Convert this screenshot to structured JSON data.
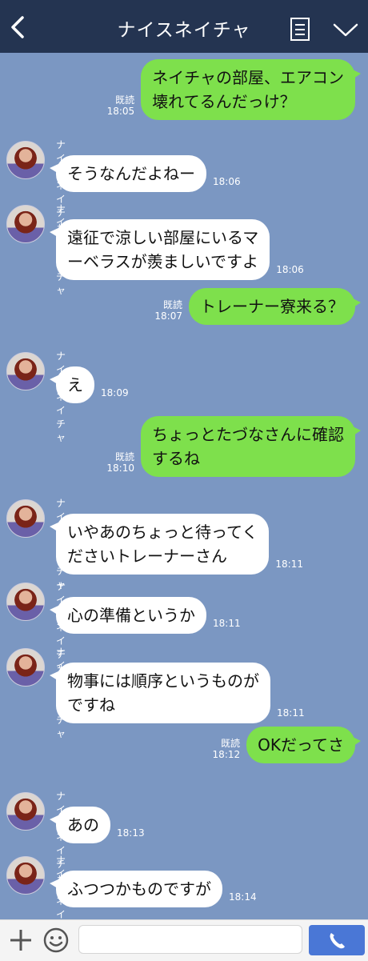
{
  "header": {
    "title": "ナイスネイチャ",
    "back_icon": "chevron-left-icon",
    "note_icon": "note-list-icon",
    "menu_icon": "chevron-down-icon"
  },
  "colors": {
    "header_bg": "#243451",
    "chat_bg": "#7b97c2",
    "outgoing_bubble": "#7ee04c",
    "incoming_bubble": "#ffffff",
    "call_button": "#4a77d6"
  },
  "messages": [
    {
      "direction": "out",
      "lines": [
        "ネイチャの部屋、エアコン",
        "壊れてるんだっけ？"
      ],
      "read_label": "既読",
      "time": "18:05"
    },
    {
      "direction": "in",
      "sender": "ナイスネイチャ",
      "lines": [
        "そうなんだよねー"
      ],
      "time": "18:06"
    },
    {
      "direction": "in",
      "sender": "ナイスネイチャ",
      "lines": [
        "遠征で涼しい部屋にいるマ",
        "ーベラスが羨ましいですよ"
      ],
      "time": "18:06"
    },
    {
      "direction": "out",
      "lines": [
        "トレーナー寮来る？"
      ],
      "read_label": "既読",
      "time": "18:07"
    },
    {
      "direction": "in",
      "sender": "ナイスネイチャ",
      "lines": [
        "え"
      ],
      "time": "18:09"
    },
    {
      "direction": "out",
      "lines": [
        "ちょっとたづなさんに確認",
        "するね"
      ],
      "read_label": "既読",
      "time": "18:10"
    },
    {
      "direction": "in",
      "sender": "ナイスネイチャ",
      "lines": [
        "いやあのちょっと待ってく",
        "ださいトレーナーさん"
      ],
      "time": "18:11"
    },
    {
      "direction": "in",
      "sender": "ナイスネイチャ",
      "lines": [
        "心の準備というか"
      ],
      "time": "18:11"
    },
    {
      "direction": "in",
      "sender": "ナイスネイチャ",
      "lines": [
        "物事には順序というものが",
        "ですね"
      ],
      "time": "18:11"
    },
    {
      "direction": "out",
      "lines": [
        "OKだってさ"
      ],
      "read_label": "既読",
      "time": "18:12"
    },
    {
      "direction": "in",
      "sender": "ナイスネイチャ",
      "lines": [
        "あの"
      ],
      "time": "18:13"
    },
    {
      "direction": "in",
      "sender": "ナイスネイチャ",
      "lines": [
        "ふつつかものですが"
      ],
      "time": "18:14"
    }
  ],
  "input_bar": {
    "plus_icon": "plus-icon",
    "emoji_icon": "emoji-icon",
    "message_value": "",
    "call_icon": "phone-icon"
  }
}
